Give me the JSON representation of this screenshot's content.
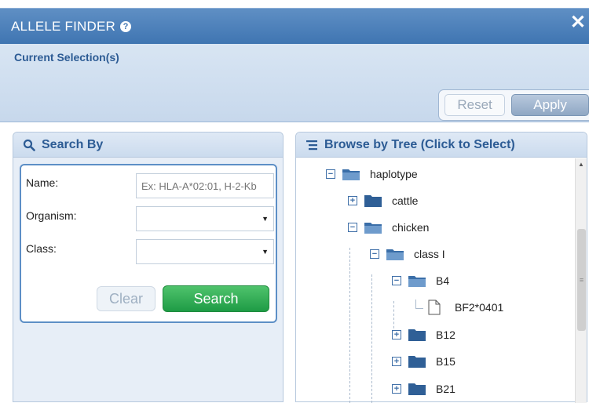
{
  "dialog": {
    "title": "ALLELE FINDER",
    "help_symbol": "?",
    "close_symbol": "✕"
  },
  "current_selection": {
    "title": "Current Selection(s)",
    "reset_label": "Reset",
    "apply_label": "Apply"
  },
  "search": {
    "header": "Search By",
    "name_label": "Name:",
    "name_placeholder": "Ex: HLA-A*02:01, H-2-Kb",
    "organism_label": "Organism:",
    "organism_value": "",
    "class_label": "Class:",
    "class_value": "",
    "clear_label": "Clear",
    "search_label": "Search"
  },
  "tree": {
    "header": "Browse by Tree (Click to Select)",
    "nodes": [
      {
        "label": "haplotype",
        "toggle": "−",
        "type": "folder-open"
      },
      {
        "label": "cattle",
        "toggle": "+",
        "type": "folder"
      },
      {
        "label": "chicken",
        "toggle": "−",
        "type": "folder-open"
      },
      {
        "label": "class I",
        "toggle": "−",
        "type": "folder-open"
      },
      {
        "label": "B4",
        "toggle": "−",
        "type": "folder-open"
      },
      {
        "label": "BF2*0401",
        "toggle": "",
        "type": "leaf"
      },
      {
        "label": "B12",
        "toggle": "+",
        "type": "folder"
      },
      {
        "label": "B15",
        "toggle": "+",
        "type": "folder"
      },
      {
        "label": "B21",
        "toggle": "+",
        "type": "folder"
      }
    ]
  },
  "colors": {
    "titlebar": "#4a7fbb",
    "accent_text": "#2c5b94",
    "search_button": "#1e9b45",
    "folder": "#3a6ea8"
  }
}
